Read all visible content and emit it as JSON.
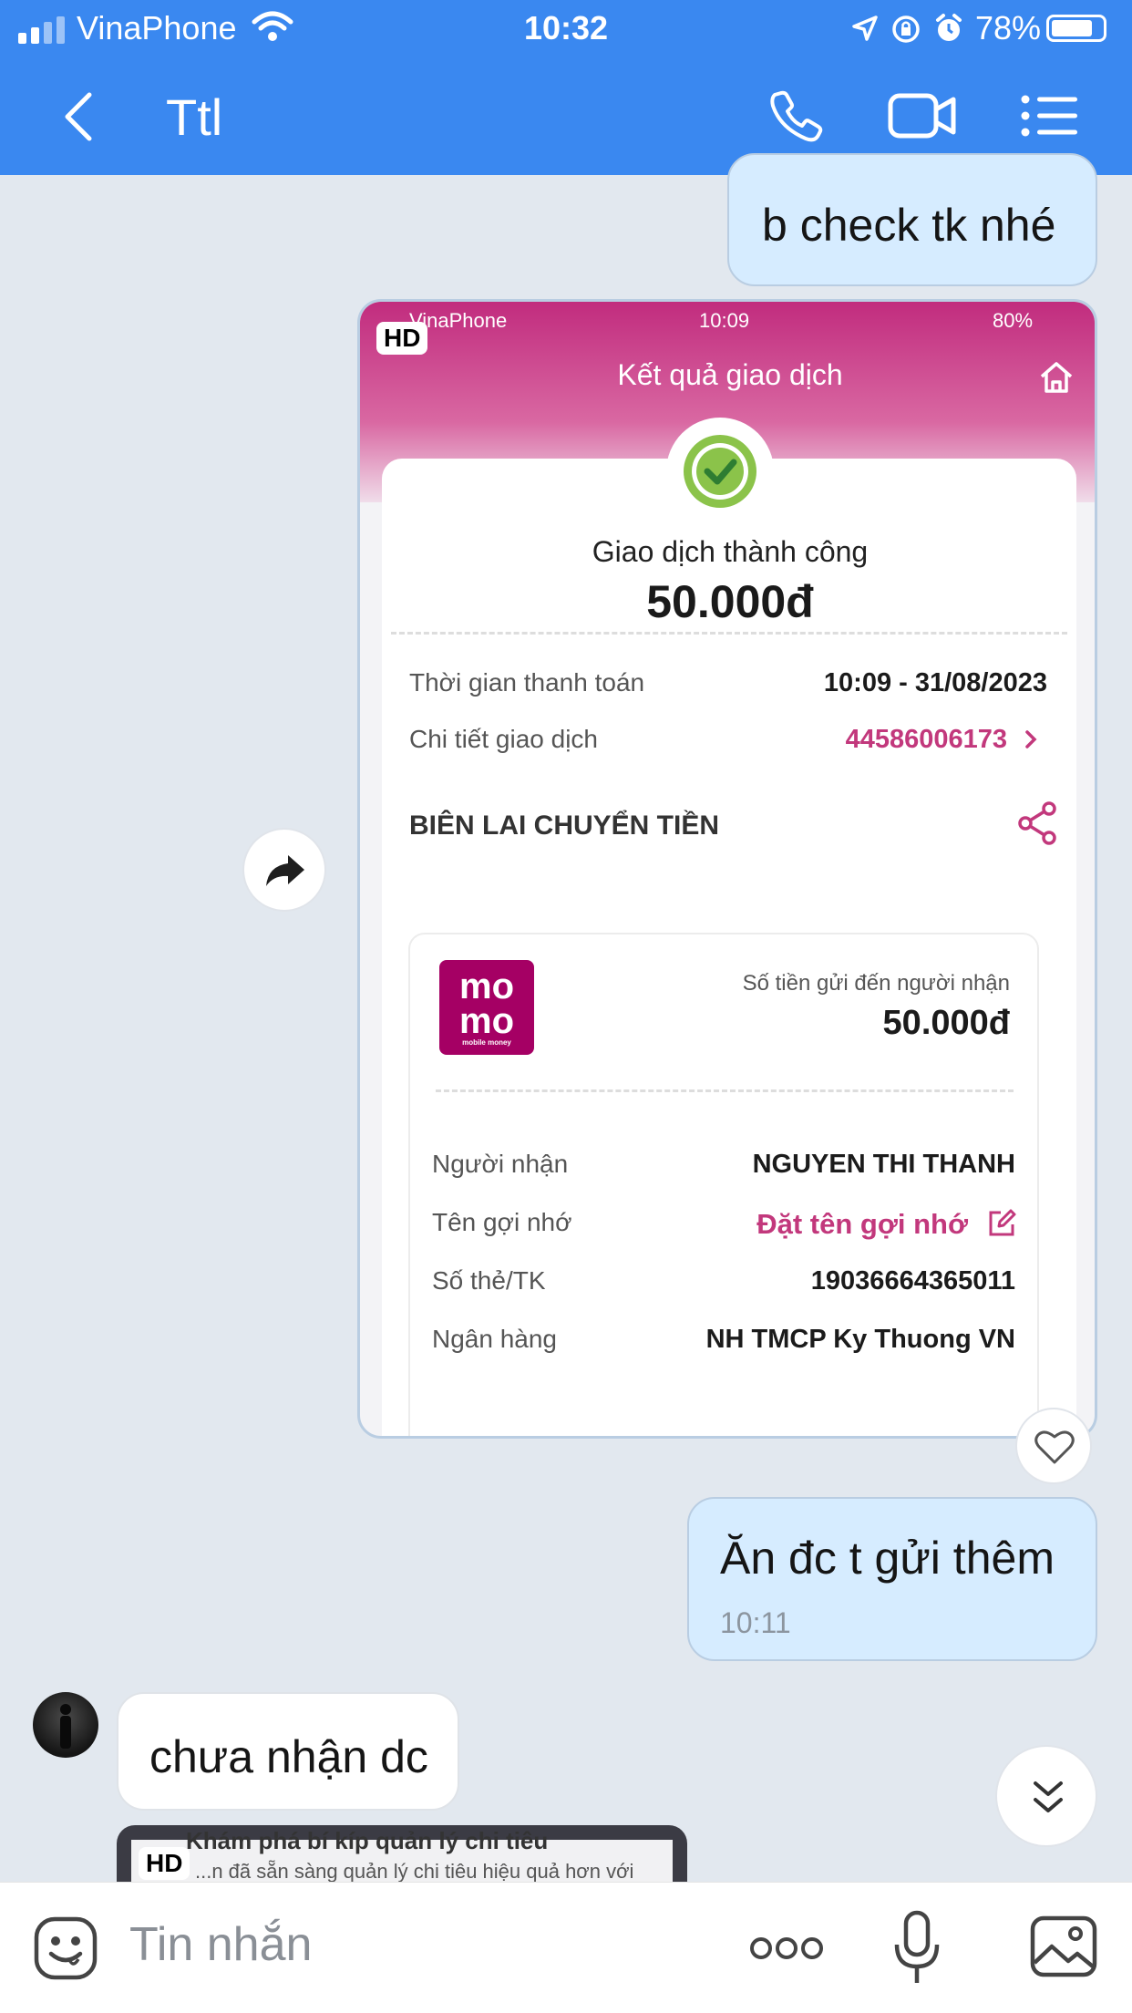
{
  "status_bar": {
    "carrier": "VinaPhone",
    "time": "10:32",
    "battery": "78%"
  },
  "header": {
    "title": "Ttl"
  },
  "messages": {
    "m1": {
      "text": "b check tk nhé"
    },
    "m2": {
      "text": "Ăn đc t gửi thêm",
      "time": "10:11"
    },
    "m3": {
      "text": "chưa nhận dc"
    }
  },
  "image_attachment": {
    "hd_badge": "HD",
    "status_bar": {
      "carrier": "VinaPhone",
      "time": "10:09",
      "battery": "80%"
    },
    "title": "Kết quả giao dịch",
    "status": "Giao dịch thành công",
    "amount": "50.000đ",
    "payment_time_label": "Thời gian thanh toán",
    "payment_time_value": "10:09 - 31/08/2023",
    "detail_label": "Chi tiết giao dịch",
    "detail_value": "44586006173",
    "receipt_title": "BIÊN LAI CHUYỂN TIỀN",
    "logo_text_1": "mo",
    "logo_text_2": "mo",
    "logo_caption": "mobile money",
    "sent_label": "Số tiền gửi đến người nhận",
    "sent_amount": "50.000đ",
    "rows": [
      {
        "label": "Người nhận",
        "value": "NGUYEN THI THANH"
      },
      {
        "label": "Tên gợi nhớ",
        "value": "Đặt tên gợi nhớ"
      },
      {
        "label": "Số thẻ/TK",
        "value": "19036664365011"
      },
      {
        "label": "Ngân hàng",
        "value": "NH TMCP Ky Thuong VN"
      }
    ]
  },
  "bottom_attachment": {
    "hd_badge": "HD",
    "text_line_1": "Khám phá bí kíp quản lý chi tiêu",
    "text_line_2": "...n đã sẵn sàng quản lý chi tiêu hiệu quả hơn với"
  },
  "input": {
    "placeholder": "Tin nhắn"
  },
  "colors": {
    "header": "#3a88f0",
    "outgoing_bubble": "#d6ecff",
    "momo_pink": "#a50064"
  }
}
